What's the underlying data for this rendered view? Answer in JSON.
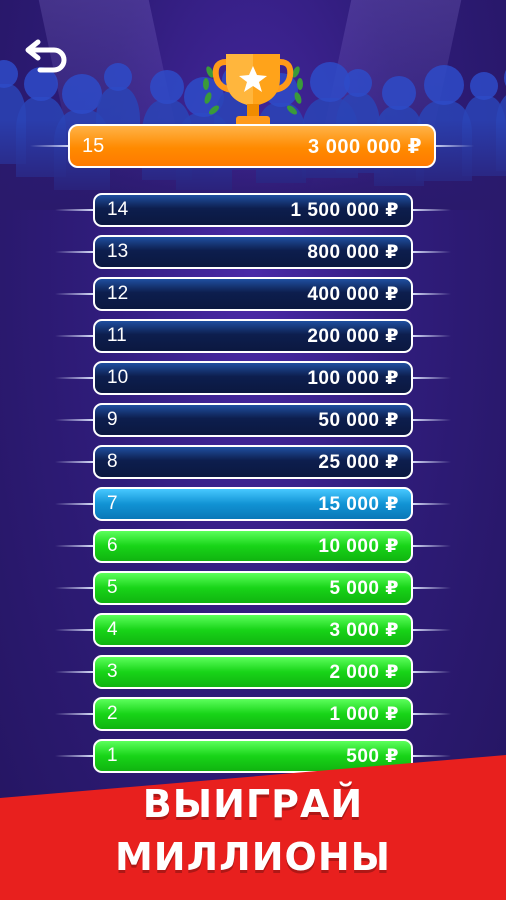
{
  "ladder": {
    "top": {
      "level": "15",
      "prize": "3 000 000 ₽"
    },
    "rows": [
      {
        "level": "14",
        "prize": "1 500 000 ₽",
        "state": "dark"
      },
      {
        "level": "13",
        "prize": "800 000 ₽",
        "state": "dark"
      },
      {
        "level": "12",
        "prize": "400 000 ₽",
        "state": "dark"
      },
      {
        "level": "11",
        "prize": "200 000 ₽",
        "state": "dark"
      },
      {
        "level": "10",
        "prize": "100 000 ₽",
        "state": "dark"
      },
      {
        "level": "9",
        "prize": "50 000 ₽",
        "state": "dark"
      },
      {
        "level": "8",
        "prize": "25 000 ₽",
        "state": "dark"
      },
      {
        "level": "7",
        "prize": "15 000 ₽",
        "state": "current"
      },
      {
        "level": "6",
        "prize": "10 000 ₽",
        "state": "won"
      },
      {
        "level": "5",
        "prize": "5 000 ₽",
        "state": "won"
      },
      {
        "level": "4",
        "prize": "3 000 ₽",
        "state": "won"
      },
      {
        "level": "3",
        "prize": "2 000 ₽",
        "state": "won"
      },
      {
        "level": "2",
        "prize": "1 000 ₽",
        "state": "won"
      },
      {
        "level": "1",
        "prize": "500 ₽",
        "state": "won"
      }
    ]
  },
  "banner": {
    "line1": "ВЫИГРАЙ",
    "line2": "МИЛЛИОНЫ"
  },
  "icons": {
    "back": "back-arrow-icon",
    "trophy": "trophy-icon"
  },
  "colors": {
    "top": "#ff8a00",
    "dark": "#0d1e4e",
    "current": "#1193d4",
    "won": "#18d418",
    "banner": "#e8201e"
  }
}
